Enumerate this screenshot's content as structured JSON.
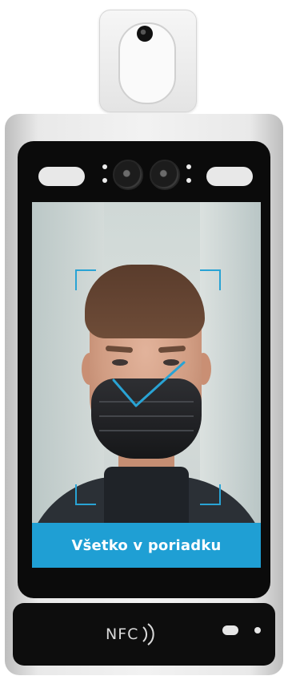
{
  "device": {
    "screen": {
      "status_text": "Všetko v poriadku",
      "status_color": "#1f9fd4",
      "frame_color": "#29a3d4",
      "result": "mask-ok"
    },
    "nfc_label": "NFC"
  }
}
